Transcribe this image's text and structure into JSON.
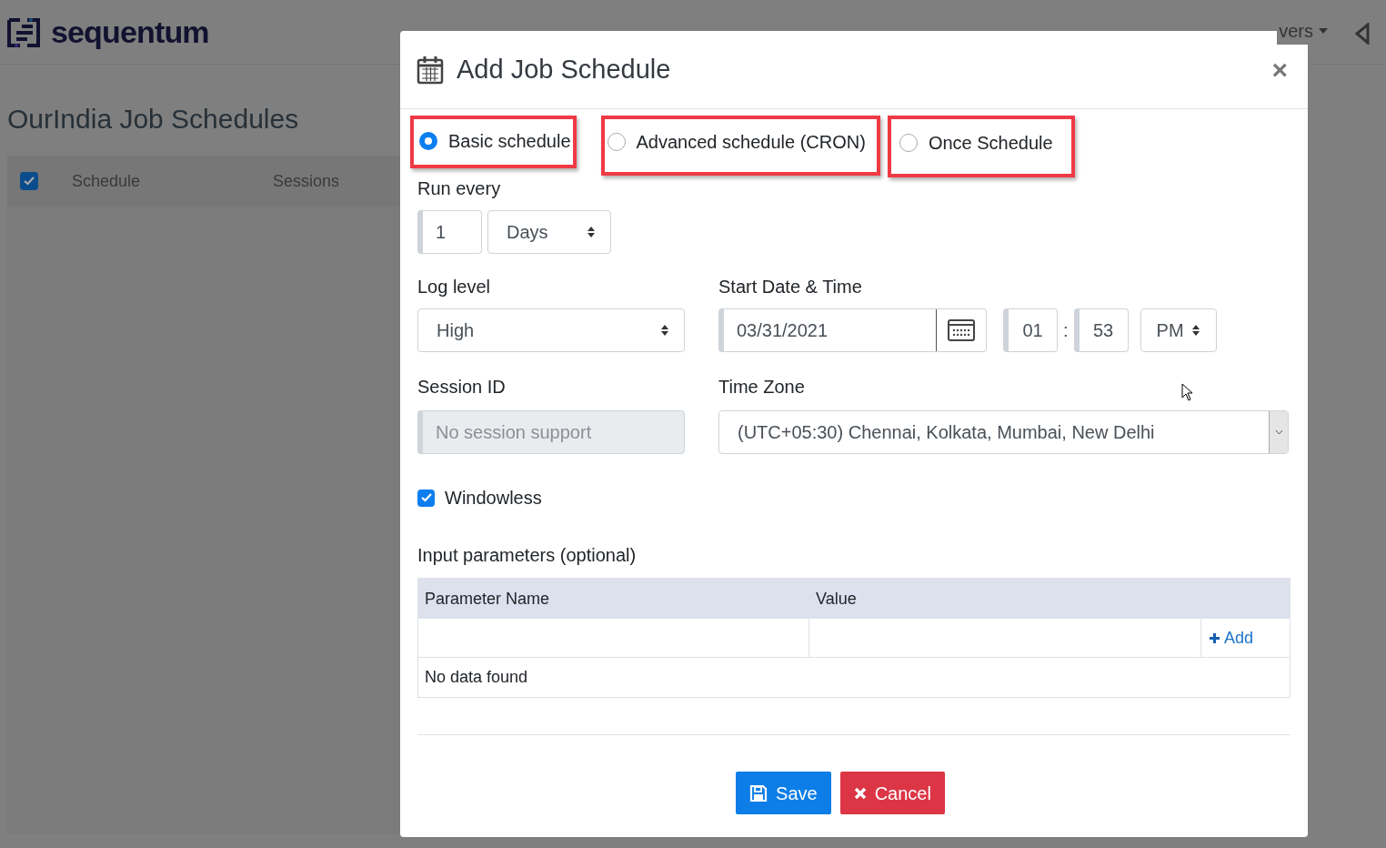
{
  "header": {
    "logo": "sequentum",
    "nav_label": "vers"
  },
  "page": {
    "title": "OurIndia Job Schedules",
    "select_all": {
      "checked": true
    },
    "columns": [
      "Schedule",
      "Sessions"
    ]
  },
  "modal": {
    "title": "Add Job Schedule",
    "close": "×",
    "schedule_types": [
      {
        "label": "Basic schedule",
        "selected": true
      },
      {
        "label": "Advanced schedule (CRON)",
        "selected": false
      },
      {
        "label": "Once Schedule",
        "selected": false
      }
    ],
    "run_every": {
      "label": "Run every",
      "value": "1",
      "unit": "Days"
    },
    "log_level": {
      "label": "Log level",
      "value": "High"
    },
    "start": {
      "label": "Start Date & Time",
      "date": "03/31/2021",
      "hour": "01",
      "separator": ":",
      "minute": "53",
      "ampm": "PM"
    },
    "session": {
      "label": "Session ID",
      "placeholder": "No session support",
      "disabled": true
    },
    "timezone": {
      "label": "Time Zone",
      "value": "(UTC+05:30) Chennai, Kolkata, Mumbai, New Delhi"
    },
    "windowless": {
      "label": "Windowless",
      "checked": true
    },
    "params": {
      "label": "Input parameters (optional)",
      "columns": [
        "Parameter Name",
        "Value"
      ],
      "add": "Add",
      "empty": "No data found"
    },
    "buttons": [
      {
        "label": "Save",
        "kind": "primary"
      },
      {
        "label": "Cancel",
        "kind": "danger"
      }
    ]
  }
}
